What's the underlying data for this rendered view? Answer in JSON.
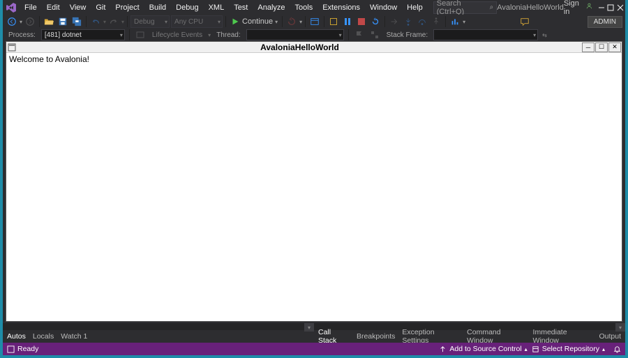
{
  "menu": [
    "File",
    "Edit",
    "View",
    "Git",
    "Project",
    "Build",
    "Debug",
    "XML",
    "Test",
    "Analyze",
    "Tools",
    "Extensions",
    "Window",
    "Help"
  ],
  "search": {
    "placeholder": "Search (Ctrl+Q)"
  },
  "solution_title": "AvaloniaHelloWorld",
  "signin": "Sign in",
  "admin_badge": "ADMIN",
  "toolbar": {
    "config_debug": "Debug",
    "config_platform": "Any CPU",
    "continue": "Continue"
  },
  "process_row": {
    "process_label": "Process:",
    "process_value": "[481] dotnet",
    "lifecycle": "Lifecycle Events",
    "thread_label": "Thread:",
    "stack_frame_label": "Stack Frame:"
  },
  "app_window": {
    "title": "AvaloniaHelloWorld",
    "body": "Welcome to Avalonia!"
  },
  "bottom_left_tabs": [
    "Autos",
    "Locals",
    "Watch 1"
  ],
  "bottom_right_tabs": [
    "Call Stack",
    "Breakpoints",
    "Exception Settings",
    "Command Window",
    "Immediate Window",
    "Output"
  ],
  "statusbar": {
    "ready": "Ready",
    "add_source": "Add to Source Control",
    "select_repo": "Select Repository"
  }
}
